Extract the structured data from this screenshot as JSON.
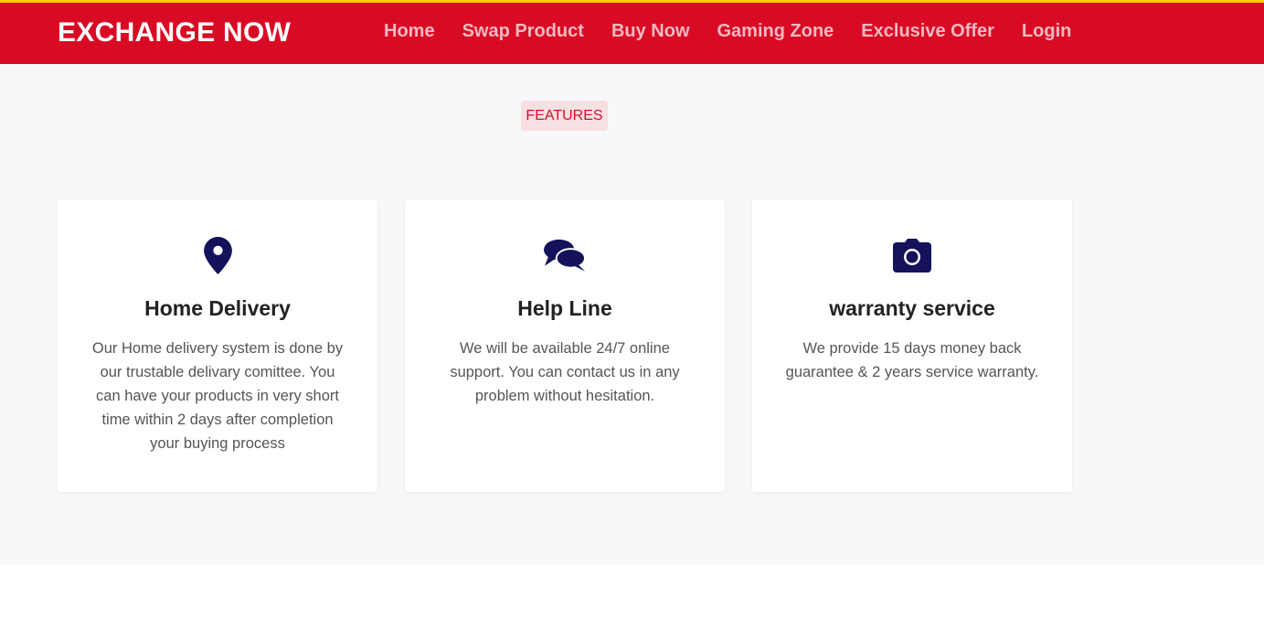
{
  "navbar": {
    "brand": "EXCHANGE NOW",
    "links": [
      "Home",
      "Swap Product",
      "Buy Now",
      "Gaming Zone",
      "Exclusive Offer",
      "Login"
    ]
  },
  "features": {
    "badge": "FEATURES",
    "cards": [
      {
        "icon": "map-marker-icon",
        "title": "Home Delivery",
        "text": "Our Home delivery system is done by our trustable delivary comittee. You can have your products in very short time within 2 days after completion your buying process"
      },
      {
        "icon": "comments-icon",
        "title": "Help Line",
        "text": "We will be available 24/7 online support. You can contact us in any problem without hesitation."
      },
      {
        "icon": "camera-icon",
        "title": "warranty service",
        "text": "We provide 15 days money back guarantee & 2 years service warranty."
      }
    ]
  },
  "colors": {
    "navbar_bg": "#d90b24",
    "top_accent": "#f2d200",
    "nav_link": "#f4b9c2",
    "icon": "#13125a",
    "badge_bg": "#f8dfe2",
    "badge_text": "#d40f2a",
    "section_bg": "#f7f8fa"
  }
}
